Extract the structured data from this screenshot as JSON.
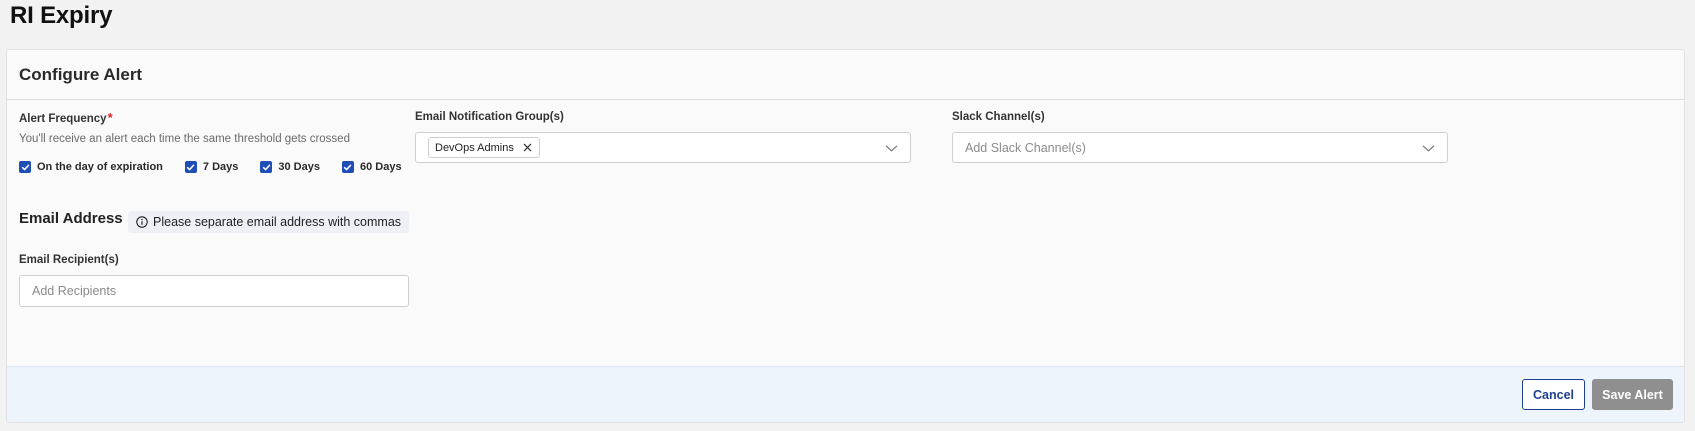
{
  "page": {
    "title": "RI Expiry"
  },
  "card": {
    "title": "Configure Alert"
  },
  "alert_frequency": {
    "label": "Alert Frequency",
    "required_mark": "*",
    "helper": "You'll receive an alert each time the same threshold gets crossed",
    "options": [
      {
        "label": "On the day of expiration",
        "checked": true
      },
      {
        "label": "7 Days",
        "checked": true
      },
      {
        "label": "30 Days",
        "checked": true
      },
      {
        "label": "60 Days",
        "checked": true
      }
    ]
  },
  "email_groups": {
    "label": "Email Notification Group(s)",
    "selected": [
      "DevOps Admins"
    ]
  },
  "slack": {
    "label": "Slack Channel(s)",
    "placeholder": "Add Slack Channel(s)"
  },
  "email_address": {
    "title": "Email Address",
    "info": "Please separate email address with commas"
  },
  "recipients": {
    "label": "Email Recipient(s)",
    "placeholder": "Add Recipients",
    "value": ""
  },
  "footer": {
    "cancel_label": "Cancel",
    "save_label": "Save Alert"
  },
  "colors": {
    "checkbox": "#1f4fb6",
    "required": "#e0202a",
    "cancel_border": "#1f3f8f",
    "save_disabled": "#8f8f8f",
    "footer_bg": "#edf4fc"
  }
}
